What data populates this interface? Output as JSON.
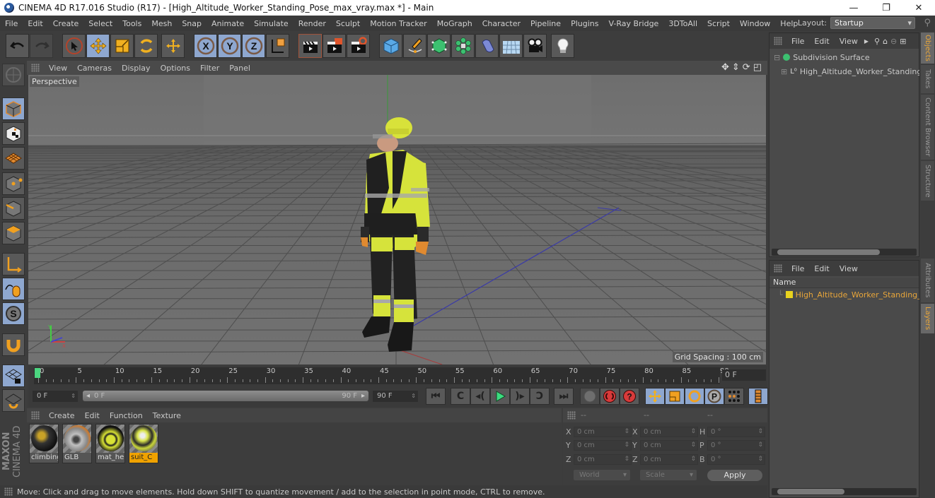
{
  "window": {
    "title": "CINEMA 4D R17.016 Studio (R17) - [High_Altitude_Worker_Standing_Pose_max_vray.max *] - Main",
    "controls": {
      "minimize": "—",
      "maximize": "❐",
      "close": "✕"
    }
  },
  "menubar": {
    "items": [
      "File",
      "Edit",
      "Create",
      "Select",
      "Tools",
      "Mesh",
      "Snap",
      "Animate",
      "Simulate",
      "Render",
      "Sculpt",
      "Motion Tracker",
      "MoGraph",
      "Character",
      "Pipeline",
      "Plugins",
      "V-Ray Bridge",
      "3DToAll",
      "Script",
      "Window",
      "Help"
    ],
    "layout_label": "Layout:",
    "layout_value": "Startup"
  },
  "toolbar": {
    "buttons": [
      {
        "name": "undo-icon",
        "active": false
      },
      {
        "name": "redo-icon",
        "active": false
      },
      {
        "name": "live-selection-icon",
        "active": false
      },
      {
        "name": "move-icon",
        "active": true
      },
      {
        "name": "scale-icon",
        "active": false
      },
      {
        "name": "rotate-icon",
        "active": false
      },
      {
        "name": "last-tool-icon",
        "active": false
      },
      {
        "name": "x-axis-lock-icon",
        "active": true,
        "label": "X"
      },
      {
        "name": "y-axis-lock-icon",
        "active": true,
        "label": "Y"
      },
      {
        "name": "z-axis-lock-icon",
        "active": true,
        "label": "Z"
      },
      {
        "name": "coordinate-system-icon",
        "active": false
      },
      {
        "name": "render-view-icon",
        "active": false
      },
      {
        "name": "render-picture-viewer-icon",
        "active": false
      },
      {
        "name": "render-settings-icon",
        "active": false
      },
      {
        "name": "cube-primitive-icon",
        "active": false
      },
      {
        "name": "pen-spline-icon",
        "active": false
      },
      {
        "name": "subdivision-surface-icon",
        "active": false
      },
      {
        "name": "cloner-icon",
        "active": false
      },
      {
        "name": "deformer-icon",
        "active": false
      },
      {
        "name": "floor-icon",
        "active": false
      },
      {
        "name": "camera-icon",
        "active": false
      },
      {
        "name": "light-icon",
        "active": false
      }
    ]
  },
  "left_toolbar": {
    "buttons": [
      "make-editable-icon",
      "model-mode-icon",
      "texture-mode-icon",
      "workplane-icon",
      "points-mode-icon",
      "edges-mode-icon",
      "polygons-mode-icon",
      "axis-mode-icon",
      "tweak-mode-icon",
      "solo-mode-icon",
      "snap-magnet-icon",
      "workplane-lock-icon",
      "locked-workplane-icon"
    ],
    "brand_line1": "MAXON",
    "brand_line2": "CINEMA 4D"
  },
  "viewport": {
    "menu": [
      "View",
      "Cameras",
      "Display",
      "Options",
      "Filter",
      "Panel"
    ],
    "camera_label": "Perspective",
    "grid_spacing": "Grid Spacing : 100 cm",
    "nav_icons": [
      "move-view-icon",
      "zoom-view-icon",
      "rotate-view-icon",
      "maximize-view-icon"
    ]
  },
  "timeline": {
    "ticks": [
      "0",
      "5",
      "10",
      "15",
      "20",
      "25",
      "30",
      "35",
      "40",
      "45",
      "50",
      "55",
      "60",
      "65",
      "70",
      "75",
      "80",
      "85",
      "90"
    ],
    "current_frame": "0 F",
    "start_frame": "0 F",
    "range_start": "0 F",
    "range_end": "90 F",
    "end_frame": "90 F",
    "playhead_frame": 0,
    "max_frame": 90
  },
  "playback": {
    "buttons": [
      "go-to-start-icon",
      "previous-key-icon",
      "previous-frame-icon",
      "play-forward-icon",
      "next-frame-icon",
      "next-key-icon",
      "go-to-end-icon",
      "record-active-objects-icon",
      "autokeying-icon",
      "keyframe-selection-icon",
      "record-position-icon",
      "record-scale-icon",
      "record-rotation-icon",
      "record-parameter-icon",
      "record-pla-icon",
      "timeline-scheme-icon"
    ]
  },
  "materials": {
    "menu": [
      "Create",
      "Edit",
      "Function",
      "Texture"
    ],
    "items": [
      {
        "label": "climbing",
        "selected": false,
        "colors": [
          "#1a1a1a",
          "#c9a227"
        ]
      },
      {
        "label": "GLB",
        "selected": false,
        "colors": [
          "#b9b9b9",
          "#d07a2a"
        ]
      },
      {
        "label": "mat_hel",
        "selected": false,
        "colors": [
          "#1e1e1e",
          "#d8e235"
        ]
      },
      {
        "label": "suit_C",
        "selected": true,
        "colors": [
          "#d9e54a",
          "#2a2a2a"
        ]
      }
    ]
  },
  "coordinates": {
    "headers": [
      "--",
      "--",
      "--"
    ],
    "rows": [
      {
        "l1": "X",
        "v1": "0 cm",
        "l2": "X",
        "v2": "0 cm",
        "l3": "H",
        "v3": "0 °"
      },
      {
        "l1": "Y",
        "v1": "0 cm",
        "l2": "Y",
        "v2": "0 cm",
        "l3": "P",
        "v3": "0 °"
      },
      {
        "l1": "Z",
        "v1": "0 cm",
        "l2": "Z",
        "v2": "0 cm",
        "l3": "B",
        "v3": "0 °"
      }
    ],
    "space": "World",
    "mode": "Scale",
    "apply": "Apply"
  },
  "status": {
    "text": "Move: Click and drag to move elements. Hold down SHIFT to quantize movement / add to the selection in point mode, CTRL to remove."
  },
  "objects_panel": {
    "menu": [
      "File",
      "Edit",
      "View"
    ],
    "objects": [
      {
        "name": "Subdivision Surface",
        "icon": "subdivision-surface-icon",
        "indent": 0
      },
      {
        "name": "High_Altitude_Worker_Standing_",
        "icon": "polygon-object-icon",
        "indent": 1
      }
    ]
  },
  "layers_panel": {
    "menu": [
      "File",
      "Edit",
      "View"
    ],
    "column": "Name",
    "layers": [
      {
        "name": "High_Altitude_Worker_Standing_P",
        "color": "#e8d21e"
      }
    ]
  },
  "side_tabs": {
    "top": [
      {
        "label": "Objects",
        "active": true
      },
      {
        "label": "Takes",
        "active": false
      },
      {
        "label": "Content Browser",
        "active": false
      },
      {
        "label": "Structure",
        "active": false
      }
    ],
    "bottom": [
      {
        "label": "Attributes",
        "active": false
      },
      {
        "label": "Layers",
        "active": true
      }
    ]
  },
  "colors": {
    "accent_active": "#8ea7cf",
    "tool_orange": "#f0a200",
    "selected_tab_text": "#e8a63a",
    "layer_text": "#e8a63a"
  }
}
